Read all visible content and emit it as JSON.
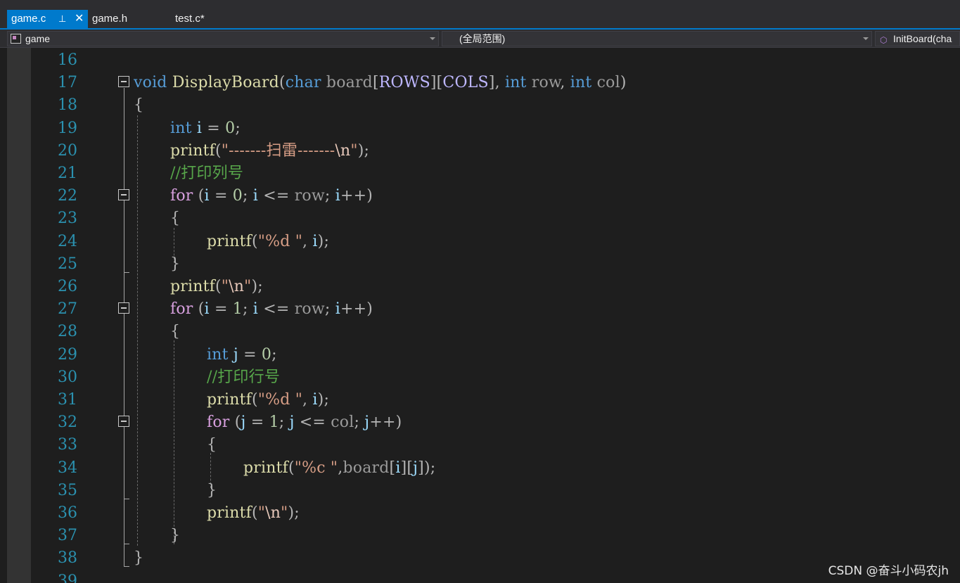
{
  "tabs": [
    {
      "label": "game.c",
      "active": true,
      "pin": "⊥",
      "close": "✕"
    },
    {
      "label": "game.h",
      "active": false
    },
    {
      "label": "test.c*",
      "active": false
    }
  ],
  "navbar": {
    "project": "game",
    "scope": "(全局范围)",
    "member": "InitBoard(cha"
  },
  "code_lines": [
    {
      "num": "16",
      "tokens": []
    },
    {
      "num": "17",
      "tokens": [
        {
          "t": "void",
          "c": "kw"
        },
        {
          "t": " ",
          "c": ""
        },
        {
          "t": "DisplayBoard",
          "c": "fn"
        },
        {
          "t": "(",
          "c": "pun"
        },
        {
          "t": "char",
          "c": "kw"
        },
        {
          "t": " ",
          "c": ""
        },
        {
          "t": "board",
          "c": "par"
        },
        {
          "t": "[",
          "c": "pun"
        },
        {
          "t": "ROWS",
          "c": "mac"
        },
        {
          "t": "][",
          "c": "pun"
        },
        {
          "t": "COLS",
          "c": "mac"
        },
        {
          "t": "], ",
          "c": "pun"
        },
        {
          "t": "int",
          "c": "kw"
        },
        {
          "t": " ",
          "c": ""
        },
        {
          "t": "row",
          "c": "par"
        },
        {
          "t": ", ",
          "c": "pun"
        },
        {
          "t": "int",
          "c": "kw"
        },
        {
          "t": " ",
          "c": ""
        },
        {
          "t": "col",
          "c": "par"
        },
        {
          "t": ")",
          "c": "pun"
        }
      ]
    },
    {
      "num": "18",
      "tokens": [
        {
          "t": "{",
          "c": "pun"
        }
      ]
    },
    {
      "num": "19",
      "tokens": [
        {
          "t": "  int",
          "c": "kw"
        },
        {
          "t": " ",
          "c": ""
        },
        {
          "t": "i",
          "c": "var"
        },
        {
          "t": " = ",
          "c": "pun"
        },
        {
          "t": "0",
          "c": "num"
        },
        {
          "t": ";",
          "c": "pun"
        }
      ]
    },
    {
      "num": "20",
      "tokens": [
        {
          "t": "  printf",
          "c": "fn"
        },
        {
          "t": "(",
          "c": "pun"
        },
        {
          "t": "\"-------扫雷-------",
          "c": "str"
        },
        {
          "t": "\\n",
          "c": "esc"
        },
        {
          "t": "\"",
          "c": "str"
        },
        {
          "t": ");",
          "c": "pun"
        }
      ]
    },
    {
      "num": "21",
      "tokens": [
        {
          "t": "  //打印列号",
          "c": "cmt"
        }
      ]
    },
    {
      "num": "22",
      "tokens": [
        {
          "t": "  for",
          "c": "kc"
        },
        {
          "t": " (",
          "c": "pun"
        },
        {
          "t": "i",
          "c": "var"
        },
        {
          "t": " = ",
          "c": "pun"
        },
        {
          "t": "0",
          "c": "num"
        },
        {
          "t": "; ",
          "c": "pun"
        },
        {
          "t": "i",
          "c": "var"
        },
        {
          "t": " <= ",
          "c": "pun"
        },
        {
          "t": "row",
          "c": "par"
        },
        {
          "t": "; ",
          "c": "pun"
        },
        {
          "t": "i",
          "c": "var"
        },
        {
          "t": "++)",
          "c": "pun"
        }
      ]
    },
    {
      "num": "23",
      "tokens": [
        {
          "t": "  {",
          "c": "pun"
        }
      ]
    },
    {
      "num": "24",
      "tokens": [
        {
          "t": "    printf",
          "c": "fn"
        },
        {
          "t": "(",
          "c": "pun"
        },
        {
          "t": "\"%d \"",
          "c": "str"
        },
        {
          "t": ", ",
          "c": "pun"
        },
        {
          "t": "i",
          "c": "var"
        },
        {
          "t": ");",
          "c": "pun"
        }
      ]
    },
    {
      "num": "25",
      "tokens": [
        {
          "t": "  }",
          "c": "pun"
        }
      ]
    },
    {
      "num": "26",
      "tokens": [
        {
          "t": "  printf",
          "c": "fn"
        },
        {
          "t": "(",
          "c": "pun"
        },
        {
          "t": "\"",
          "c": "str"
        },
        {
          "t": "\\n",
          "c": "esc"
        },
        {
          "t": "\"",
          "c": "str"
        },
        {
          "t": ");",
          "c": "pun"
        }
      ]
    },
    {
      "num": "27",
      "tokens": [
        {
          "t": "  for",
          "c": "kc"
        },
        {
          "t": " (",
          "c": "pun"
        },
        {
          "t": "i",
          "c": "var"
        },
        {
          "t": " = ",
          "c": "pun"
        },
        {
          "t": "1",
          "c": "num"
        },
        {
          "t": "; ",
          "c": "pun"
        },
        {
          "t": "i",
          "c": "var"
        },
        {
          "t": " <= ",
          "c": "pun"
        },
        {
          "t": "row",
          "c": "par"
        },
        {
          "t": "; ",
          "c": "pun"
        },
        {
          "t": "i",
          "c": "var"
        },
        {
          "t": "++)",
          "c": "pun"
        }
      ]
    },
    {
      "num": "28",
      "tokens": [
        {
          "t": "  {",
          "c": "pun"
        }
      ]
    },
    {
      "num": "29",
      "tokens": [
        {
          "t": "    int",
          "c": "kw"
        },
        {
          "t": " ",
          "c": ""
        },
        {
          "t": "j",
          "c": "var"
        },
        {
          "t": " = ",
          "c": "pun"
        },
        {
          "t": "0",
          "c": "num"
        },
        {
          "t": ";",
          "c": "pun"
        }
      ]
    },
    {
      "num": "30",
      "tokens": [
        {
          "t": "    //打印行号",
          "c": "cmt"
        }
      ]
    },
    {
      "num": "31",
      "tokens": [
        {
          "t": "    printf",
          "c": "fn"
        },
        {
          "t": "(",
          "c": "pun"
        },
        {
          "t": "\"%d \"",
          "c": "str"
        },
        {
          "t": ", ",
          "c": "pun"
        },
        {
          "t": "i",
          "c": "var"
        },
        {
          "t": ");",
          "c": "pun"
        }
      ]
    },
    {
      "num": "32",
      "tokens": [
        {
          "t": "    for",
          "c": "kc"
        },
        {
          "t": " (",
          "c": "pun"
        },
        {
          "t": "j",
          "c": "var"
        },
        {
          "t": " = ",
          "c": "pun"
        },
        {
          "t": "1",
          "c": "num"
        },
        {
          "t": "; ",
          "c": "pun"
        },
        {
          "t": "j",
          "c": "var"
        },
        {
          "t": " <= ",
          "c": "pun"
        },
        {
          "t": "col",
          "c": "par"
        },
        {
          "t": "; ",
          "c": "pun"
        },
        {
          "t": "j",
          "c": "var"
        },
        {
          "t": "++)",
          "c": "pun"
        }
      ]
    },
    {
      "num": "33",
      "tokens": [
        {
          "t": "    {",
          "c": "pun"
        }
      ]
    },
    {
      "num": "34",
      "tokens": [
        {
          "t": "      printf",
          "c": "fn"
        },
        {
          "t": "(",
          "c": "pun"
        },
        {
          "t": "\"%c \"",
          "c": "str"
        },
        {
          "t": ",",
          "c": "pun"
        },
        {
          "t": "board",
          "c": "par"
        },
        {
          "t": "[",
          "c": "pun"
        },
        {
          "t": "i",
          "c": "var"
        },
        {
          "t": "][",
          "c": "pun"
        },
        {
          "t": "j",
          "c": "var"
        },
        {
          "t": "]);",
          "c": "pun"
        }
      ]
    },
    {
      "num": "35",
      "tokens": [
        {
          "t": "    }",
          "c": "pun"
        }
      ]
    },
    {
      "num": "36",
      "tokens": [
        {
          "t": "    printf",
          "c": "fn"
        },
        {
          "t": "(",
          "c": "pun"
        },
        {
          "t": "\"",
          "c": "str"
        },
        {
          "t": "\\n",
          "c": "esc"
        },
        {
          "t": "\"",
          "c": "str"
        },
        {
          "t": ");",
          "c": "pun"
        }
      ]
    },
    {
      "num": "37",
      "tokens": [
        {
          "t": "  }",
          "c": "pun"
        }
      ]
    },
    {
      "num": "38",
      "tokens": [
        {
          "t": "}",
          "c": "pun"
        }
      ]
    },
    {
      "num": "39",
      "tokens": []
    }
  ],
  "watermark": "CSDN @奋斗小码农jh"
}
